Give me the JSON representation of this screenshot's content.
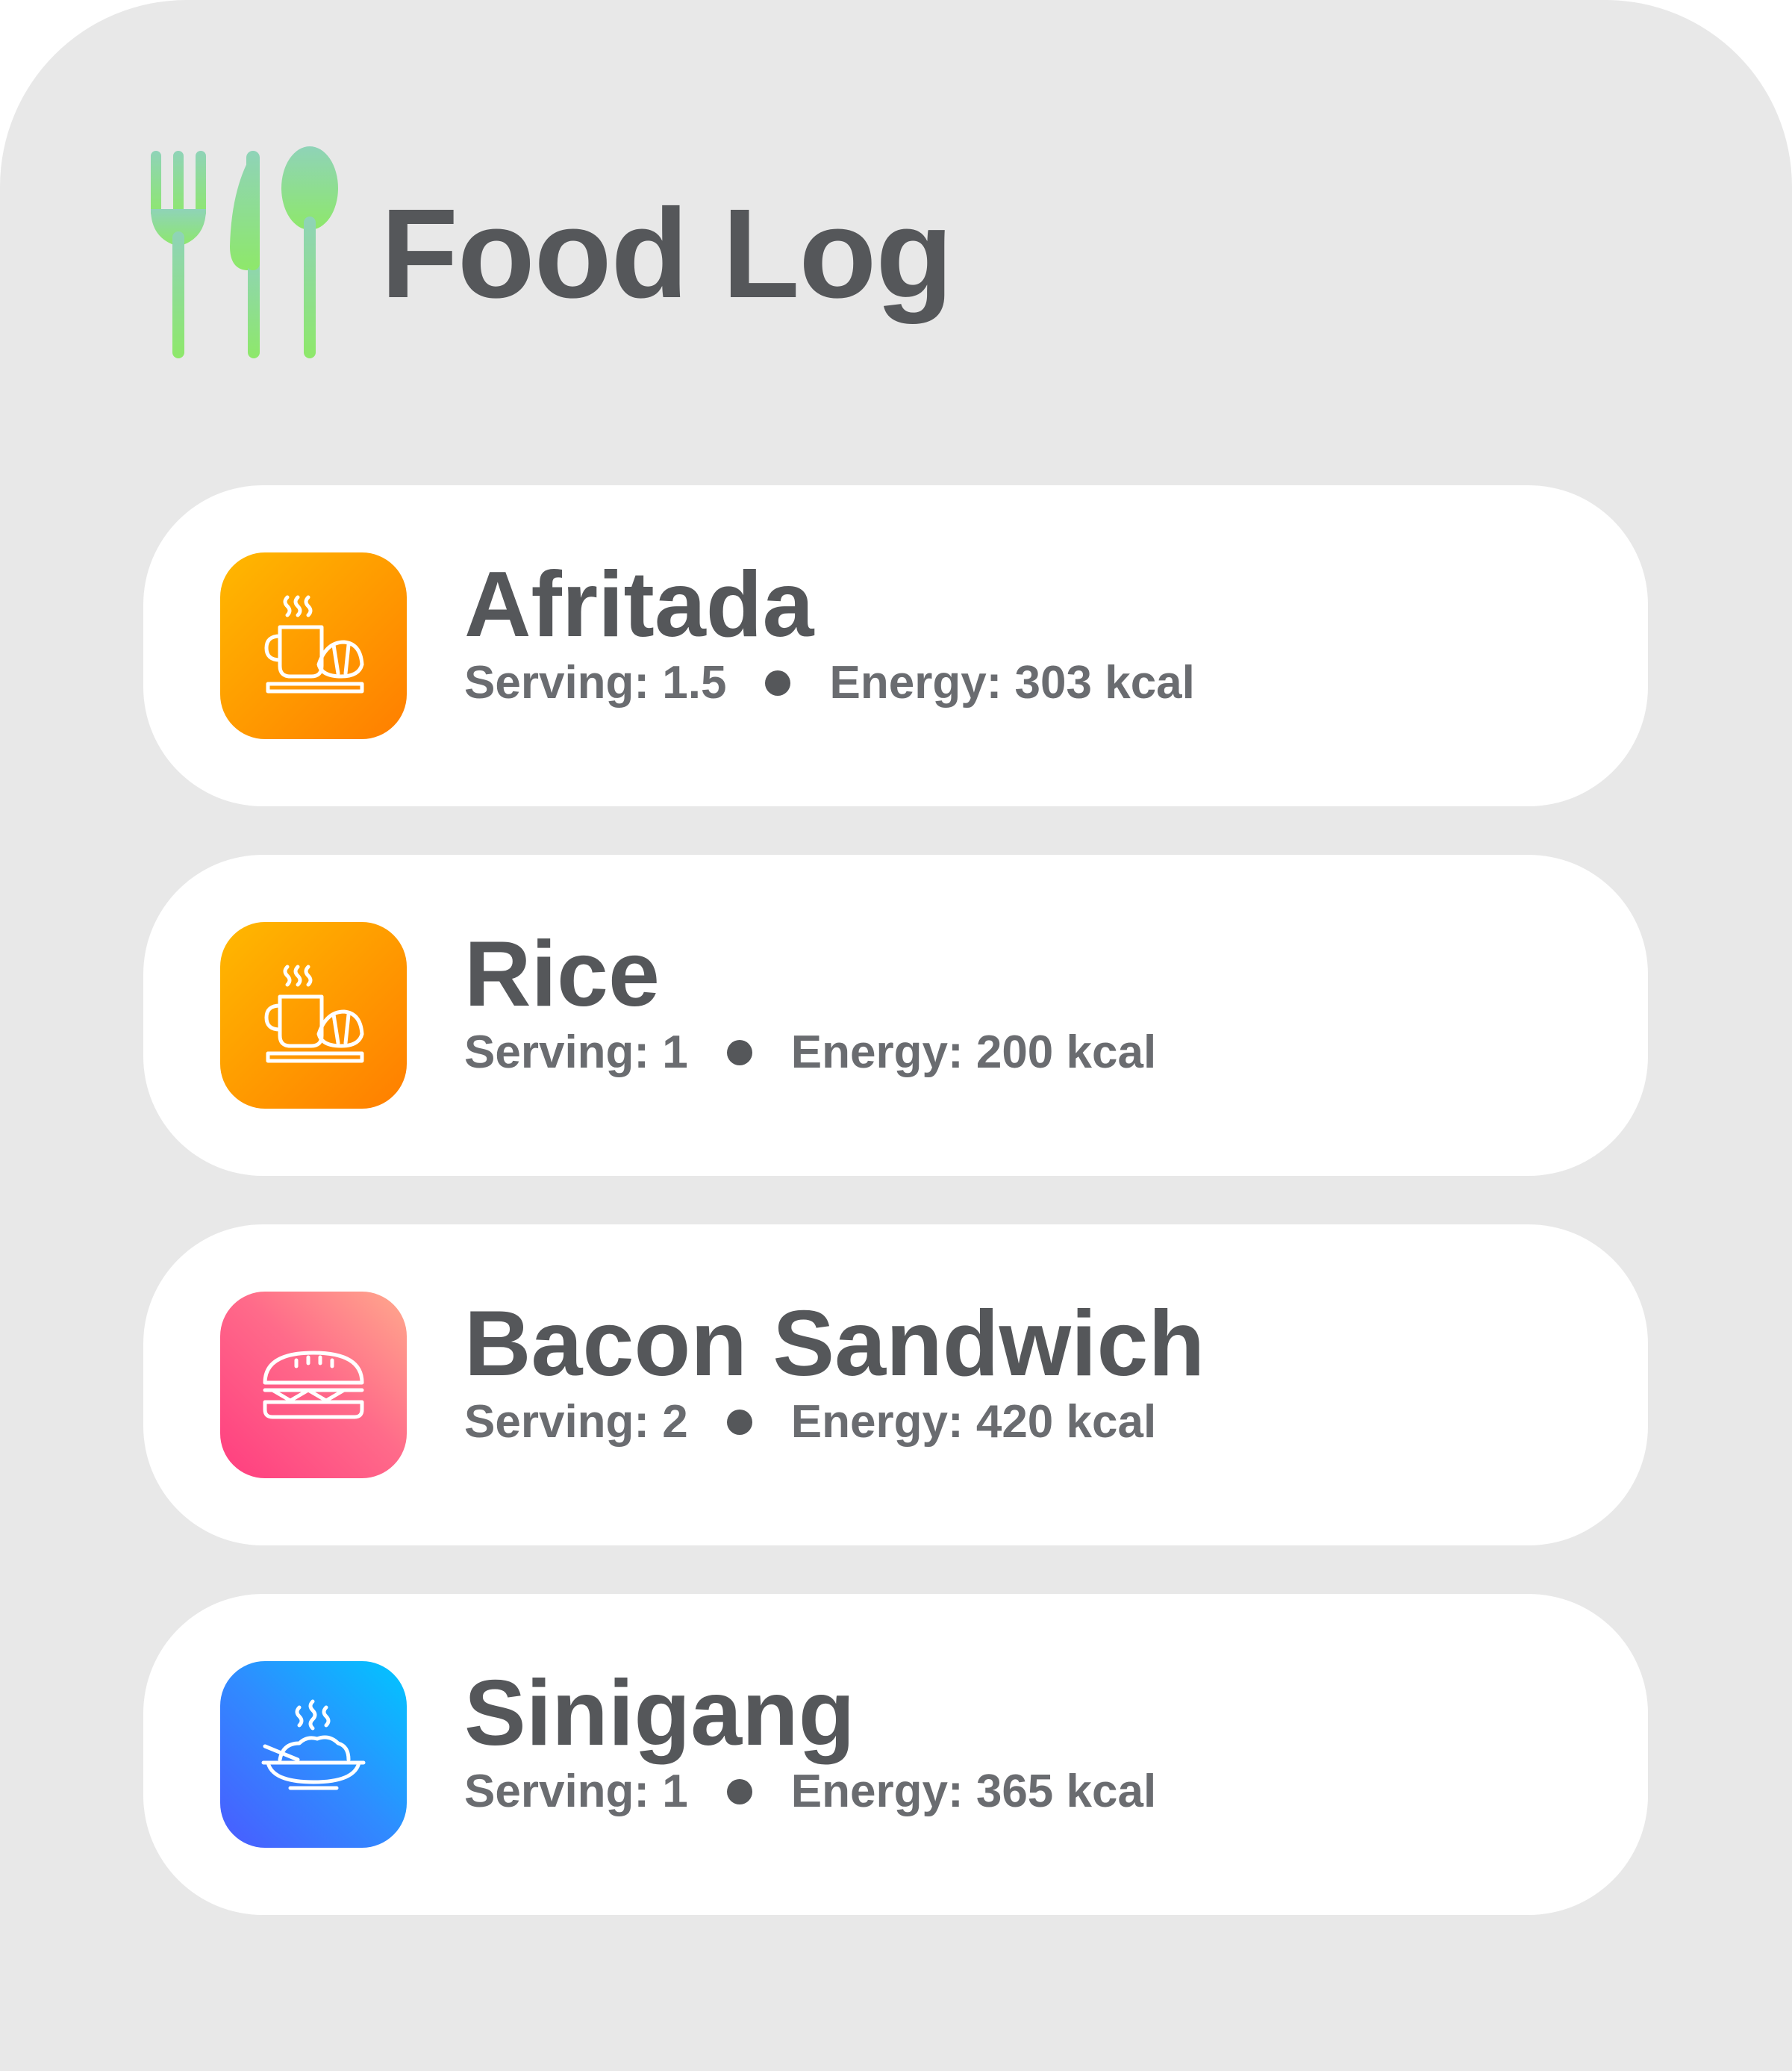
{
  "header": {
    "title": "Food Log",
    "icon": "utensils-icon",
    "icon_colors": [
      "#8fd3b8",
      "#8ee86a"
    ]
  },
  "entries": [
    {
      "name": "Afritada",
      "serving_label": "Serving: 1.5",
      "energy_label": "Energy: 303 kcal",
      "icon": "coffee-croissant-icon",
      "tile_color": "orange"
    },
    {
      "name": "Rice",
      "serving_label": "Serving: 1",
      "energy_label": "Energy: 200 kcal",
      "icon": "coffee-croissant-icon",
      "tile_color": "orange"
    },
    {
      "name": "Bacon Sandwich",
      "serving_label": "Serving: 2",
      "energy_label": "Energy: 420 kcal",
      "icon": "sandwich-icon",
      "tile_color": "pink"
    },
    {
      "name": "Sinigang",
      "serving_label": "Serving: 1",
      "energy_label": "Energy: 365 kcal",
      "icon": "hot-dish-icon",
      "tile_color": "blue"
    }
  ],
  "colors": {
    "background": "#e8e8e8",
    "card": "#ffffff",
    "title_text": "#55575a",
    "meta_text": "#6a6c70",
    "orange_tile": [
      "#ffb800",
      "#ff7e00"
    ],
    "pink_tile": [
      "#ff3d7f",
      "#ffa98c"
    ],
    "blue_tile": [
      "#4a5bff",
      "#00c6ff"
    ]
  }
}
